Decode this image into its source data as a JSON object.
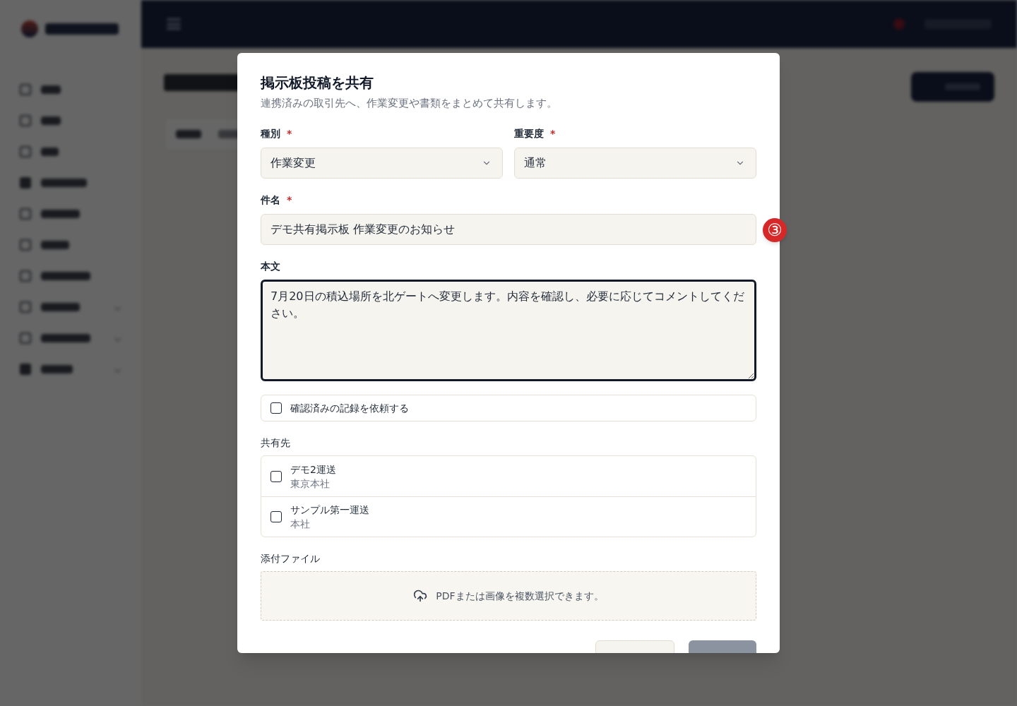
{
  "modal": {
    "title": "掲示板投稿を共有",
    "description": "連携済みの取引先へ、作業変更や書類をまとめて共有します。"
  },
  "selects": [
    {
      "label": "種別",
      "required_mark": "*",
      "value": "作業変更"
    },
    {
      "label": "重要度",
      "required_mark": "*",
      "value": "通常"
    }
  ],
  "subject": {
    "label": "件名",
    "required_mark": "*",
    "value": "デモ共有掲示板 作業変更のお知らせ"
  },
  "body": {
    "label": "本文",
    "value": "7月20日の積込場所を北ゲートへ変更します。内容を確認し、必要に応じてコメントしてください。",
    "focused": true
  },
  "confirm_request": {
    "label": "確認済みの記録を依頼する",
    "checked": false
  },
  "recipients": {
    "label": "共有先",
    "items": [
      {
        "name": "デモ2運送",
        "branch": "東京本社",
        "checked": false
      },
      {
        "name": "サンプル第一運送",
        "branch": "本社",
        "checked": false
      }
    ]
  },
  "attachments": {
    "label": "添付ファイル",
    "hint": "PDFまたは画像を複数選択できます。"
  },
  "footer_buttons": [
    {
      "kind": "secondary",
      "disabled": false
    },
    {
      "kind": "primary",
      "disabled": true
    }
  ],
  "annotation": {
    "marker": "③"
  }
}
